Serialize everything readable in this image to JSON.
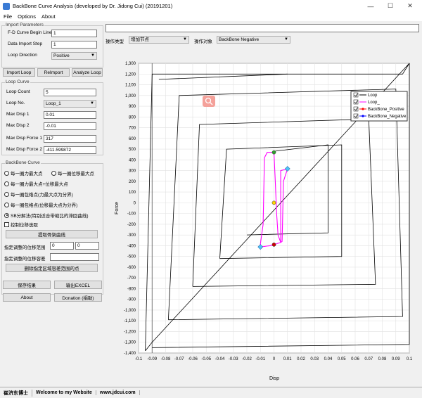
{
  "window": {
    "title": "BackBone Curve Analysis (developed by Dr. Jidong Cui) (20191201)",
    "minimize": "—",
    "maximize": "☐",
    "close": "✕"
  },
  "menu": {
    "file": "File",
    "options": "Options",
    "about": "About"
  },
  "import": {
    "group_title": "Import Parameters",
    "begin_line_label": "F-D Curve Begin Line",
    "begin_line_value": "1",
    "step_label": "Data Import Step",
    "step_value": "1",
    "direction_label": "Loop Direction",
    "direction_value": "Positive",
    "import_loop": "Import Loop",
    "reimport": "ReImport",
    "analyze_loop": "Analyze Loop"
  },
  "loop": {
    "group_title": "Loop Curve",
    "count_label": "Loop Count",
    "count_value": "5",
    "no_label": "Loop No.",
    "no_value": "Loop_1",
    "maxdisp1_label": "Max Disp 1",
    "maxdisp1_value": "0.01",
    "maxdisp2_label": "Max Disp 2",
    "maxdisp2_value": "-0.01",
    "maxforce1_label": "Max Disp Force 1",
    "maxforce1_value": "317",
    "maxforce2_label": "Max Disp Force 2",
    "maxforce2_value": "-411.599872"
  },
  "backbone": {
    "group_title": "BackBone Curve",
    "opt1": "每一圈力最大点",
    "opt2": "每一圈位移最大点",
    "opt3": "每一圈力最大点+位移最大点",
    "opt4": "每一圈包络点(力最大点为分界)",
    "opt5": "每一圈包络点(位移最大点为分界)",
    "opt6": "SB分解法(特别适合带缩比的滞回曲线)",
    "control_check": "控制位移选取",
    "extract_btn": "提取骨架曲线",
    "range_label": "指定调整的位移范围",
    "range_from": "0",
    "range_to": "0",
    "tol_label": "指定调整的位移容差",
    "tol_value": "",
    "delete_btn": "删除指定区域容差范围的点"
  },
  "actions": {
    "save": "保存结果",
    "export": "输出EXCEL",
    "about": "About",
    "donation": "Donation (捐助)"
  },
  "toolbar": {
    "op_type_label": "操作类型",
    "op_type_value": "增加节点",
    "op_target_label": "操作对象",
    "op_target_value": "BackBone Negative",
    "top_input": ""
  },
  "status": {
    "author": "崔济东博士",
    "welcome": "Welcome to my Website",
    "site": "www.jdcui.com"
  },
  "colors": {
    "loop": "#000000",
    "loop_sel": "#ff00ff",
    "bb_pos": "#ff0000",
    "bb_neg": "#0000ff",
    "point_green": "#2e9e2e",
    "point_cyan": "#4fc3f7",
    "point_yellow": "#ffd700",
    "point_red": "#cc0000",
    "zoom_icon_bg": "#f4a19a"
  },
  "icons": {
    "zoom": "zoom-icon",
    "app": "app-icon"
  },
  "chart_data": {
    "type": "line",
    "xlabel": "Disp",
    "ylabel": "Force",
    "xlim": [
      -0.1,
      0.1
    ],
    "ylim": [
      -1400,
      1300
    ],
    "xticks": [
      "-0.1",
      "-0.09",
      "-0.08",
      "-0.07",
      "-0.06",
      "-0.05",
      "-0.04",
      "-0.03",
      "-0.02",
      "-0.01",
      "0",
      "0.01",
      "0.02",
      "0.03",
      "0.04",
      "0.05",
      "0.06",
      "0.07",
      "0.08",
      "0.09",
      "0.1"
    ],
    "yticks": [
      "1,300",
      "1,200",
      "1,100",
      "1,000",
      "900",
      "800",
      "700",
      "600",
      "500",
      "400",
      "300",
      "200",
      "100",
      "0",
      "-100",
      "-200",
      "-300",
      "-400",
      "-500",
      "-600",
      "-700",
      "-800",
      "-900",
      "-1,000",
      "-1,100",
      "-1,200",
      "-1,300",
      "-1,400"
    ],
    "grid": true,
    "legend_position": "top-right",
    "legend": [
      "Loop",
      "Loop_",
      "BackBone_Positive",
      "BackBone_Negative"
    ],
    "series": [
      {
        "name": "Loop",
        "loops": [
          [
            [
              -0.095,
              -1380
            ],
            [
              -0.09,
              -1300
            ],
            [
              0.1,
              1300
            ],
            [
              0.095,
              1200
            ],
            [
              -0.09,
              1200
            ],
            [
              -0.095,
              -1380
            ]
          ],
          [
            [
              -0.09,
              -1350
            ],
            [
              0.1,
              -1320
            ],
            [
              0.1,
              1300
            ]
          ],
          [
            [
              -0.085,
              1150
            ],
            [
              0.01,
              1200
            ]
          ],
          [
            [
              -0.078,
              -1090
            ],
            [
              0.095,
              -1060
            ],
            [
              0.09,
              1060
            ],
            [
              -0.07,
              1000
            ],
            [
              -0.078,
              -1090
            ]
          ],
          [
            [
              -0.06,
              -780
            ],
            [
              0.075,
              -760
            ],
            [
              0.07,
              780
            ],
            [
              -0.055,
              730
            ],
            [
              -0.06,
              -780
            ]
          ],
          [
            [
              -0.04,
              -520
            ],
            [
              0.05,
              -500
            ],
            [
              0.05,
              540
            ],
            [
              -0.035,
              500
            ],
            [
              -0.04,
              -520
            ]
          ],
          [
            [
              -0.02,
              -300
            ],
            [
              0.04,
              -280
            ],
            [
              0.04,
              540
            ],
            [
              0.0,
              480
            ]
          ]
        ]
      },
      {
        "name": "Loop_",
        "points": [
          [
            -0.01,
            -411.6
          ],
          [
            -0.01,
            -380
          ],
          [
            -0.008,
            -200
          ],
          [
            -0.007,
            420
          ],
          [
            -0.005,
            470
          ],
          [
            0.0,
            470
          ],
          [
            0.001,
            200
          ],
          [
            0.002,
            -100
          ],
          [
            0.003,
            -300
          ],
          [
            0.005,
            -370
          ],
          [
            0.005,
            300
          ],
          [
            0.008,
            310
          ],
          [
            0.01,
            317
          ],
          [
            0.007,
            200
          ],
          [
            0.006,
            -360
          ],
          [
            0.005,
            -370
          ],
          [
            0.0,
            -390
          ],
          [
            -0.003,
            -400
          ],
          [
            -0.01,
            -411.6
          ]
        ]
      }
    ],
    "markers": [
      {
        "x": 0.0,
        "y": 470,
        "color": "green"
      },
      {
        "x": 0.01,
        "y": 317,
        "color": "cyan"
      },
      {
        "x": 0.0,
        "y": 0,
        "color": "yellow"
      },
      {
        "x": 0.0,
        "y": -390,
        "color": "red"
      },
      {
        "x": -0.01,
        "y": -411.6,
        "color": "cyan"
      }
    ]
  }
}
